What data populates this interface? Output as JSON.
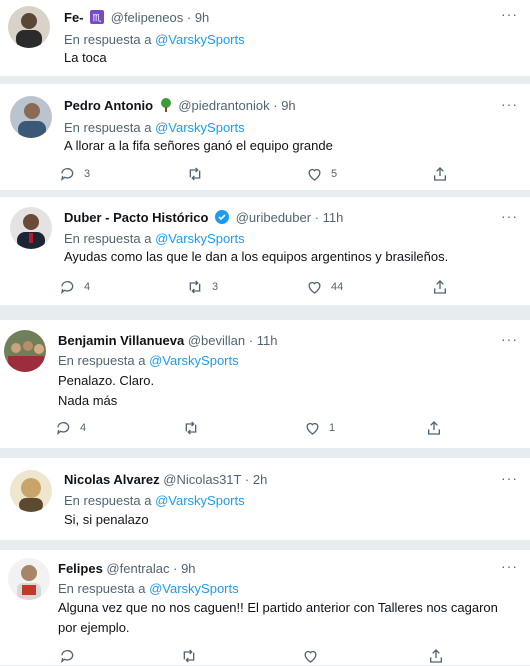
{
  "tweets": [
    {
      "name": "Fe-",
      "zodiac_glyph": "♏",
      "handle": "@felipeneos",
      "time": "9h",
      "reply_prefix": "En respuesta a",
      "reply_to": "@VarskySports",
      "lines": [
        "La toca"
      ],
      "actions": null
    },
    {
      "name": "Pedro Antonio",
      "handle": "@piedrantoniok",
      "time": "9h",
      "reply_prefix": "En respuesta a",
      "reply_to": "@VarskySports",
      "lines": [
        "A llorar a la fifa señores ganó el equipo grande"
      ],
      "actions": {
        "replies": "3",
        "retweets": "",
        "likes": "5"
      }
    },
    {
      "name": "Duber - Pacto Histórico",
      "handle": "@uribeduber",
      "time": "11h",
      "reply_prefix": "En respuesta a",
      "reply_to": "@VarskySports",
      "lines": [
        "Ayudas como las que le dan a los equipos argentinos y brasileños."
      ],
      "actions": {
        "replies": "4",
        "retweets": "3",
        "likes": "44"
      }
    },
    {
      "name": "Benjamin Villanueva",
      "handle": "@bevillan",
      "time": "11h",
      "reply_prefix": "En respuesta a",
      "reply_to": "@VarskySports",
      "lines": [
        "Penalazo. Claro.",
        "Nada más"
      ],
      "actions": {
        "replies": "4",
        "retweets": "",
        "likes": "1"
      }
    },
    {
      "name": "Nicolas Alvarez",
      "handle": "@Nicolas31T",
      "time": "2h",
      "reply_prefix": "En respuesta a",
      "reply_to": "@VarskySports",
      "lines": [
        "Si, si penalazo"
      ],
      "actions": null
    },
    {
      "name": "Felipes",
      "handle": "@fentralac",
      "time": "9h",
      "reply_prefix": "En respuesta a",
      "reply_to": "@VarskySports",
      "lines": [
        "Alguna vez que no nos caguen!! El partido anterior con Talleres nos cagaron",
        "por ejemplo."
      ],
      "actions": {
        "replies": "",
        "retweets": "",
        "likes": ""
      }
    }
  ],
  "more_glyph": "···",
  "separator": "·",
  "colors": {
    "link": "#1d9bf0",
    "muted": "#536471",
    "verified": "#1d9bf0",
    "zodiac": "#794bc4",
    "background": "#e6ecf0"
  },
  "icons": [
    "reply-icon",
    "retweet-icon",
    "like-icon",
    "share-icon",
    "verified-badge-icon",
    "tree-emoji-icon",
    "more-icon"
  ]
}
